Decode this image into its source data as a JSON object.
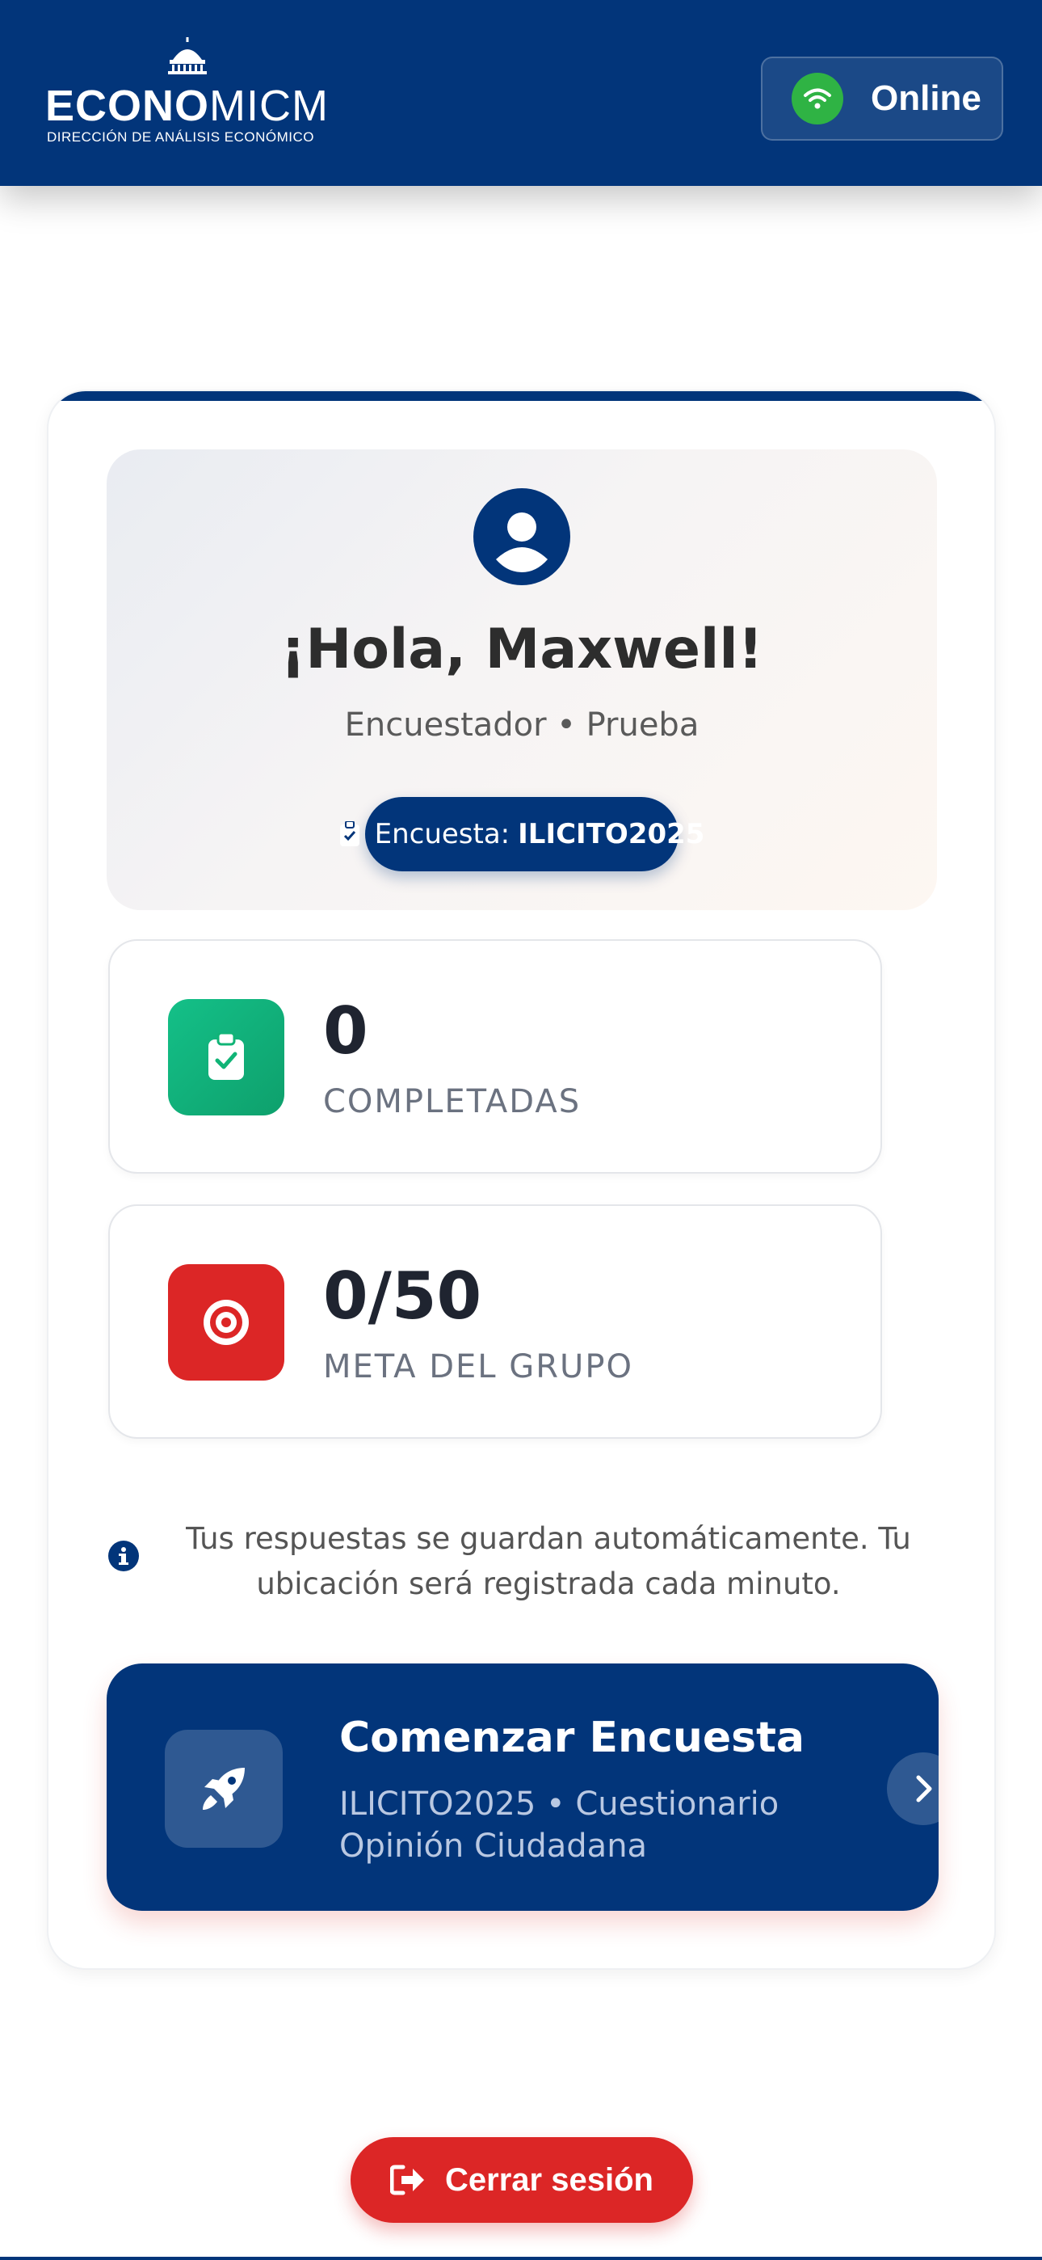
{
  "header": {
    "logo_bold": "ECONO",
    "logo_light": "MICM",
    "logo_subtitle": "DIRECCIÓN DE ANÁLISIS ECONÓMICO",
    "status_label": "Online",
    "status_icon": "wifi-icon",
    "status_color": "#2fb344",
    "bg_color": "#02357a"
  },
  "welcome": {
    "avatar_icon": "user-icon",
    "greeting": "¡Hola, Maxwell!",
    "role": "Encuestador • Prueba",
    "survey_prefix": "Encuesta:",
    "survey_code": "ILICITO2025"
  },
  "stats": [
    {
      "value": "0",
      "label": "COMPLETADAS",
      "icon": "clipboard-check-icon",
      "color": "#10b476"
    },
    {
      "value": "0/50",
      "label": "META DEL GRUPO",
      "icon": "target-icon",
      "color": "#dc2626"
    }
  ],
  "info": {
    "icon": "info-icon",
    "text": "Tus respuestas se guardan automáticamente. Tu ubicación será registrada cada minuto."
  },
  "start": {
    "icon": "rocket-icon",
    "title": "Comenzar Encuesta",
    "subtitle": "ILICITO2025 • Cuestionario Opinión Ciudadana",
    "chevron_icon": "chevron-right-icon"
  },
  "logout": {
    "label": "Cerrar sesión",
    "icon": "sign-out-icon",
    "color": "#dc2626"
  }
}
